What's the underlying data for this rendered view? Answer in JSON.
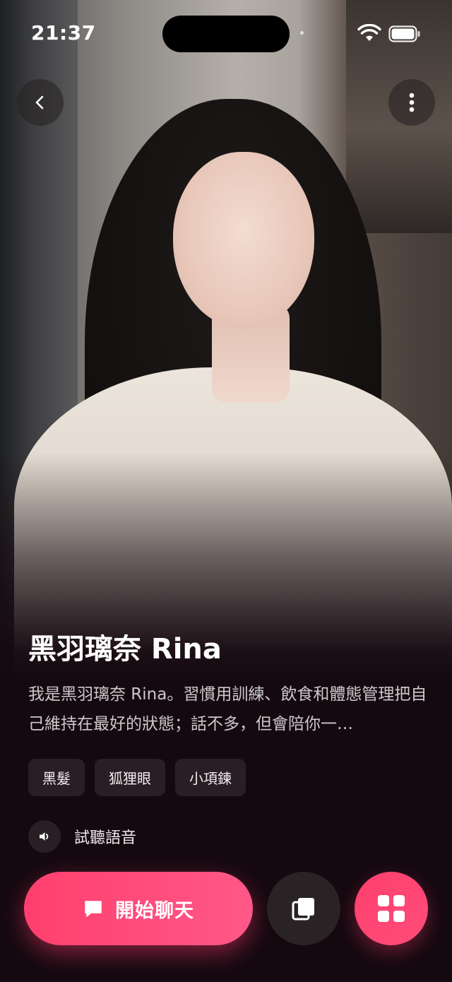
{
  "status_bar": {
    "time": "21:37",
    "icons": [
      "wifi-icon",
      "battery-icon"
    ]
  },
  "top_bar": {
    "back_icon": "chevron-left-icon",
    "more_icon": "more-vertical-icon"
  },
  "profile": {
    "name": "黑羽璃奈 Rina",
    "description": "我是黑羽璃奈 Rina。習慣用訓練、飲食和體態管理把自己維持在最好的狀態；話不多，但會陪你一…",
    "tags": [
      "黑髮",
      "狐狸眼",
      "小項鍊"
    ],
    "voice_label": "試聽語音"
  },
  "actions": {
    "start_chat_label": "開始聊天",
    "start_chat_icon": "chat-bubble-icon",
    "copy_icon": "copy-icon",
    "grid_icon": "grid-icon"
  },
  "colors": {
    "accent": "#ff4474",
    "background": "#150910",
    "chip": "#2a1e25"
  }
}
